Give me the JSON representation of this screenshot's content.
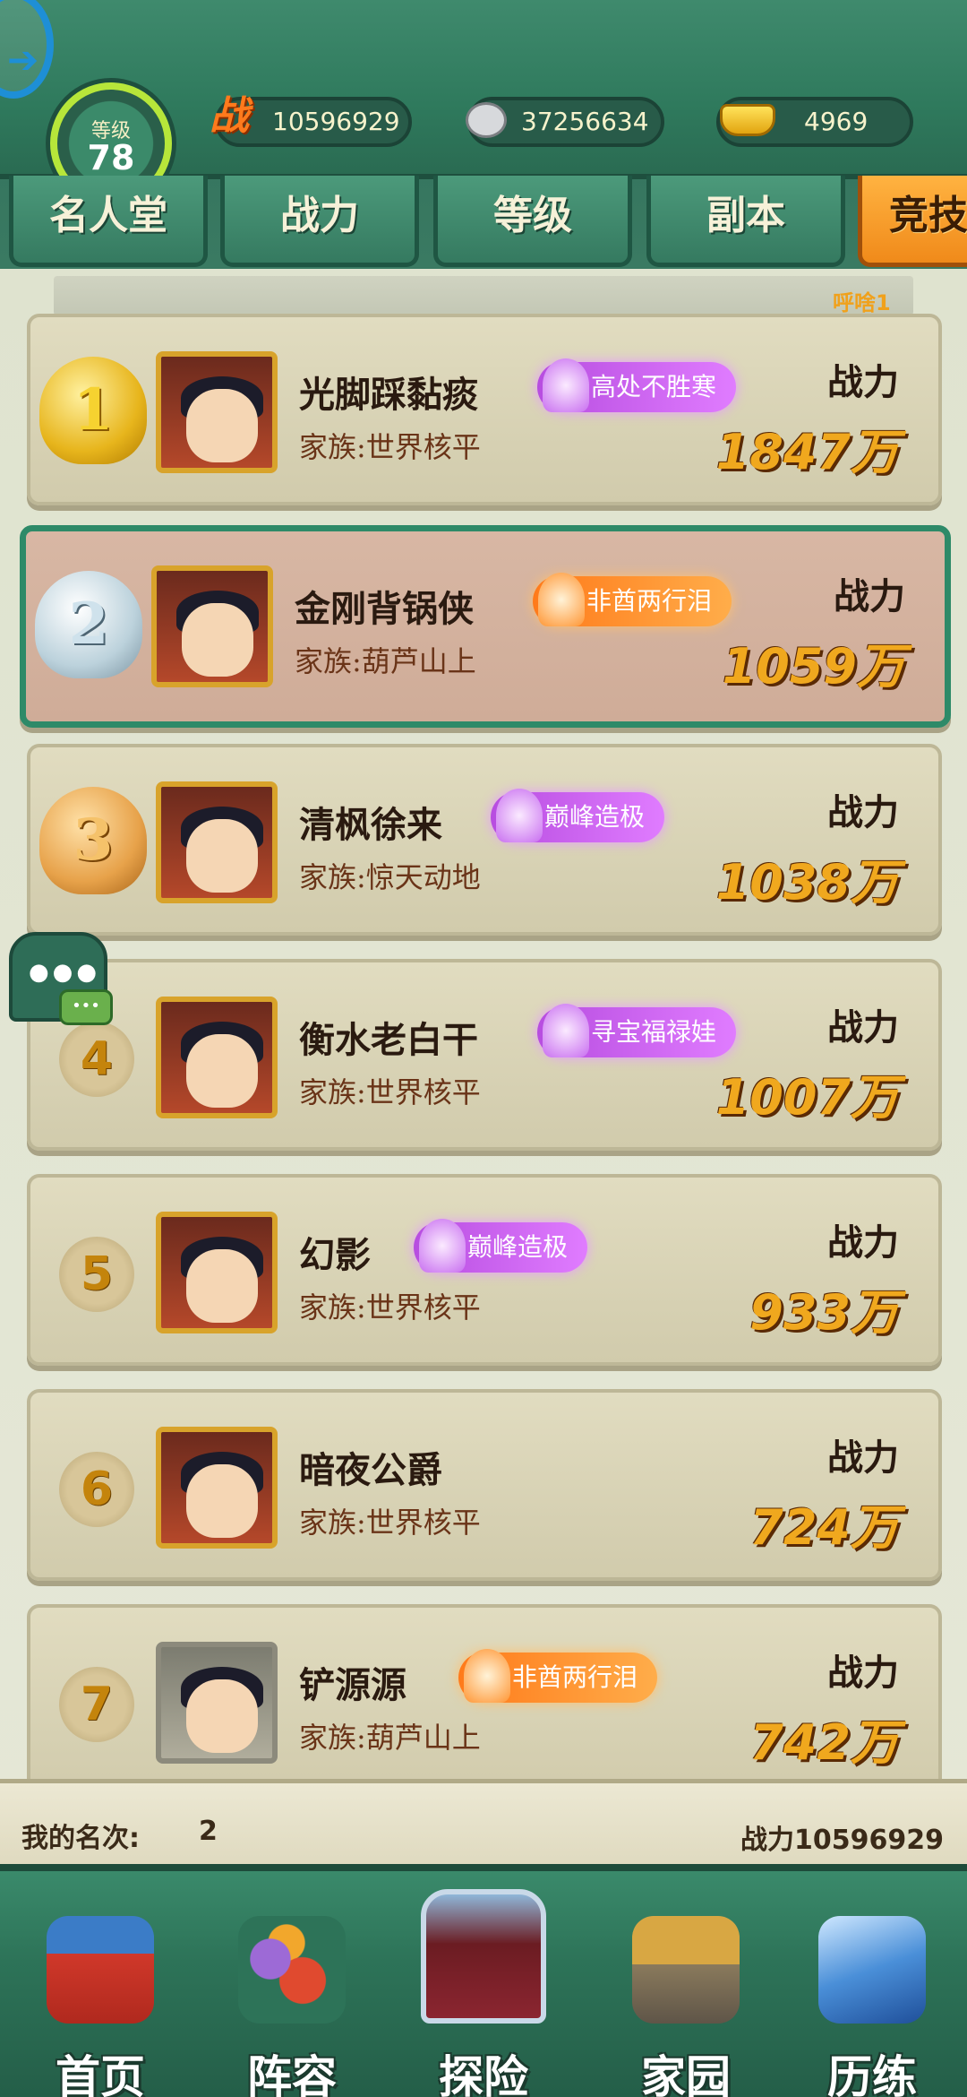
{
  "header": {
    "level_label": "等级",
    "level_value": "78",
    "power_icon": "战",
    "power_value": "10596929",
    "silver_value": "37256634",
    "gold_value": "4969"
  },
  "tabs": [
    {
      "label": "名人堂"
    },
    {
      "label": "战力"
    },
    {
      "label": "等级"
    },
    {
      "label": "副本"
    },
    {
      "label": "竞技"
    }
  ],
  "ticker": "呼啥1",
  "rankings": [
    {
      "rank": "1",
      "name": "光脚踩黏痰",
      "family": "家族:世界核平",
      "title": "高处不胜寒",
      "title_style": "purple",
      "power_label": "战力",
      "power": "1847万"
    },
    {
      "rank": "2",
      "name": "金刚背锅侠",
      "family": "家族:葫芦山上",
      "title": "非酋两行泪",
      "title_style": "orange",
      "power_label": "战力",
      "power": "1059万"
    },
    {
      "rank": "3",
      "name": "清枫徐来",
      "family": "家族:惊天动地",
      "title": "巅峰造极",
      "title_style": "purple",
      "power_label": "战力",
      "power": "1038万"
    },
    {
      "rank": "4",
      "name": "衡水老白干",
      "family": "家族:世界核平",
      "title": "寻宝福禄娃",
      "title_style": "purple",
      "power_label": "战力",
      "power": "1007万"
    },
    {
      "rank": "5",
      "name": "幻影",
      "family": "家族:世界核平",
      "title": "巅峰造极",
      "title_style": "purple",
      "power_label": "战力",
      "power": "933万"
    },
    {
      "rank": "6",
      "name": "暗夜公爵",
      "family": "家族:世界核平",
      "title": "",
      "title_style": "none",
      "power_label": "战力",
      "power": "724万"
    },
    {
      "rank": "7",
      "name": "铲源源",
      "family": "家族:葫芦山上",
      "title": "非酋两行泪",
      "title_style": "orange",
      "power_label": "战力",
      "power": "742万"
    }
  ],
  "my_rank": {
    "label": "我的名次:",
    "value": "2",
    "power": "战力10596929"
  },
  "nav": [
    {
      "label": "首页",
      "icon": "palace-icon"
    },
    {
      "label": "阵容",
      "icon": "gourd-icon"
    },
    {
      "label": "探险",
      "icon": "gate-icon"
    },
    {
      "label": "家园",
      "icon": "house-icon"
    },
    {
      "label": "历练",
      "icon": "sword-mountain-icon"
    }
  ],
  "colors": {
    "accent_green": "#2f7a5d",
    "tab_active": "#f08a1a",
    "power_gold": "#f0a81e",
    "highlight_border": "#2e8a68"
  }
}
